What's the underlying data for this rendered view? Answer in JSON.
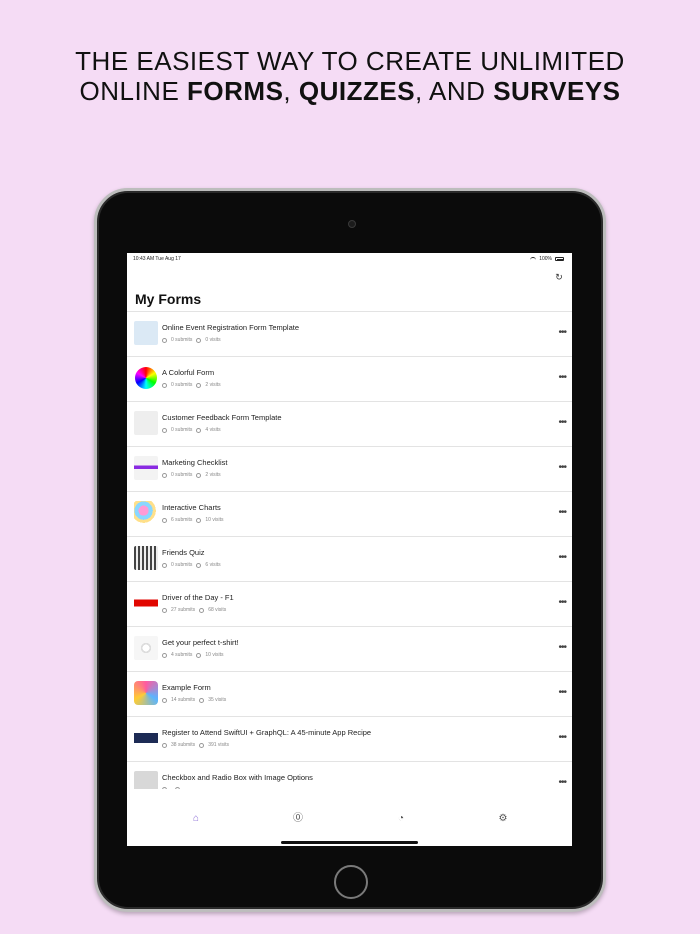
{
  "headline": {
    "line1": "THE EASIEST WAY TO CREATE UNLIMITED",
    "line2_prefix": "ONLINE ",
    "forms": "FORMS",
    "sep1": ", ",
    "quizzes": "QUIZZES",
    "sep2": ", AND ",
    "surveys": "SURVEYS"
  },
  "status_bar": {
    "time": "10:43 AM  Tue Aug 17",
    "battery": "100%"
  },
  "screen": {
    "title": "My Forms",
    "refresh_icon": "refresh-icon"
  },
  "forms": [
    {
      "title": "Online Event Registration Form Template",
      "submits": "0 submits",
      "visits": "0 visits",
      "thumb": "lightblue"
    },
    {
      "title": "A Colorful Form",
      "submits": "0 submits",
      "visits": "2 visits",
      "thumb": "spectrum"
    },
    {
      "title": "Customer Feedback Form Template",
      "submits": "0 submits",
      "visits": "4 visits",
      "thumb": "plain"
    },
    {
      "title": "Marketing Checklist",
      "submits": "0 submits",
      "visits": "2 visits",
      "thumb": "purple"
    },
    {
      "title": "Interactive Charts",
      "submits": "6 submits",
      "visits": "10 visits",
      "thumb": "pastel"
    },
    {
      "title": "Friends Quiz",
      "submits": "0 submits",
      "visits": "6 visits",
      "thumb": "quiz"
    },
    {
      "title": "Driver of the Day - F1",
      "submits": "27 submits",
      "visits": "68 visits",
      "thumb": "f1"
    },
    {
      "title": "Get your perfect t-shirt!",
      "submits": "4 submits",
      "visits": "10 visits",
      "thumb": "tshirt"
    },
    {
      "title": "Example Form",
      "submits": "14 submits",
      "visits": "35 visits",
      "thumb": "pinwheel"
    },
    {
      "title": "Register to Attend SwiftUI + GraphQL: A 45-minute App Recipe",
      "submits": "38 submits",
      "visits": "391 visits",
      "thumb": "banner"
    },
    {
      "title": "Checkbox and Radio Box with Image Options",
      "submits": "",
      "visits": "",
      "thumb": "grey"
    }
  ],
  "tabbar": {
    "items": [
      "home-icon",
      "payments-icon",
      "analytics-icon",
      "settings-icon"
    ],
    "active": "home-icon",
    "accent": "#8a6cd6"
  }
}
